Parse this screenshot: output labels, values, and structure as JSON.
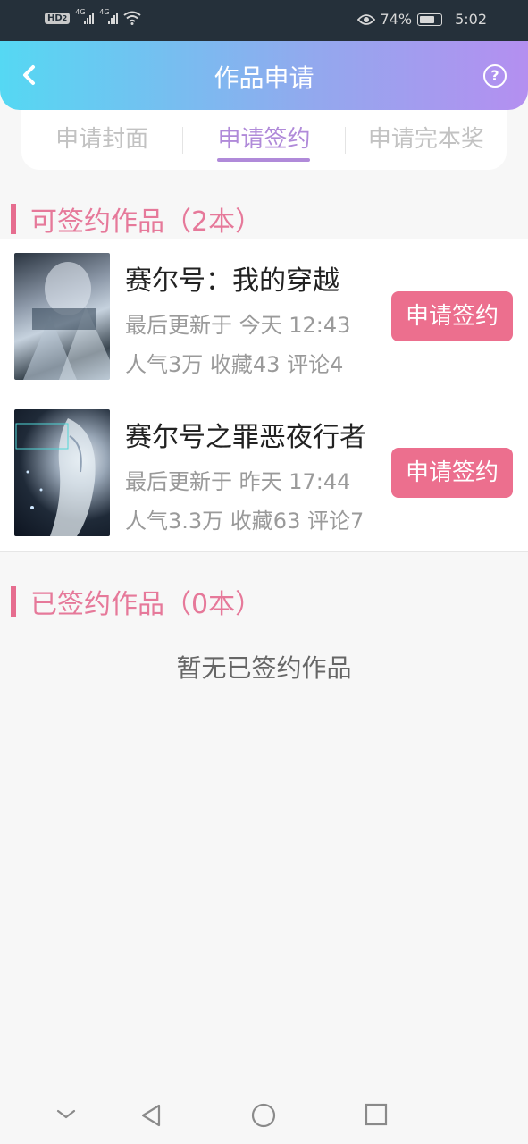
{
  "status_bar": {
    "hd_label": "HD",
    "hd_sub": "2",
    "net1": "4G",
    "net2": "4G",
    "battery": "74%",
    "time": "5:02"
  },
  "header": {
    "title": "作品申请",
    "back_icon": "chevron-left-icon",
    "help_icon": "question-circle-icon"
  },
  "tabs": [
    {
      "label": "申请封面",
      "active": false
    },
    {
      "label": "申请签约",
      "active": true
    },
    {
      "label": "申请完本奖",
      "active": false
    }
  ],
  "signable_section": {
    "title": "可签约作品（2本）",
    "works": [
      {
        "title": "赛尔号：我的穿越",
        "updated": "最后更新于 今天 12:43",
        "stats": "人气3万 收藏43 评论4",
        "button": "申请签约"
      },
      {
        "title": "赛尔号之罪恶夜行者",
        "updated": "最后更新于 昨天 17:44",
        "stats": "人气3.3万 收藏63 评论7",
        "button": "申请签约"
      }
    ]
  },
  "signed_section": {
    "title": "已签约作品（0本）",
    "empty_text": "暂无已签约作品"
  },
  "colors": {
    "accent_pink": "#ec6f8e",
    "tab_active": "#b08ad9",
    "header_gradient_start": "#55d8f3",
    "header_gradient_end": "#b48ff0"
  }
}
